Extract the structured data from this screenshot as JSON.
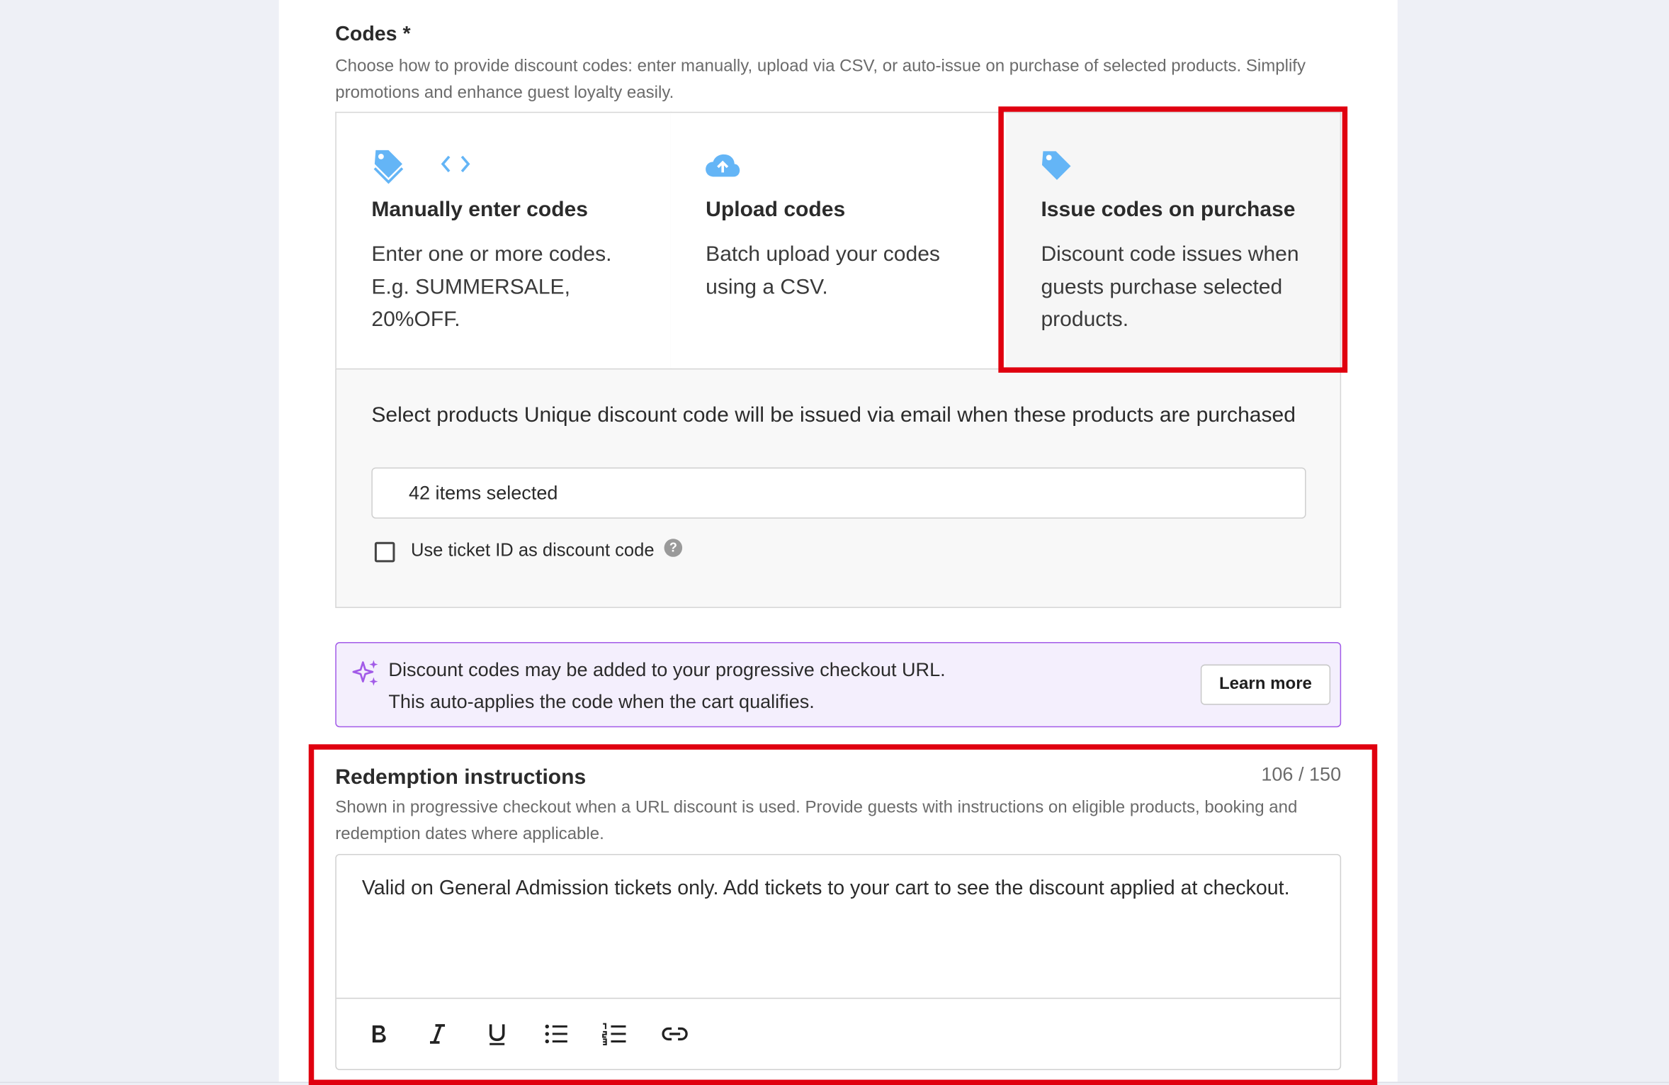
{
  "codes": {
    "title": "Codes *",
    "description": "Choose how to provide discount codes: enter manually, upload via CSV, or auto-issue on purchase of selected products. Simplify promotions and enhance guest loyalty easily."
  },
  "options": [
    {
      "title": "Manually enter codes",
      "description": "Enter one or more codes. E.g. SUMMERSALE, 20%OFF.",
      "icon": "tag-icon"
    },
    {
      "title": "Upload codes",
      "description": "Batch upload your codes using a CSV.",
      "icon": "cloud-upload-icon"
    },
    {
      "title": "Issue codes on purchase",
      "description": "Discount code issues when guests purchase selected products.",
      "icon": "tag-icon",
      "selected": true
    }
  ],
  "select_products": {
    "label": "Select products Unique discount code will be issued via email when these products are purchased",
    "value": "42 items selected",
    "checkbox_label": "Use ticket ID as discount code",
    "checkbox_checked": false
  },
  "banner": {
    "line1": "Discount codes may be added to your progressive checkout URL.",
    "line2": "This auto-applies the code when the cart qualifies.",
    "button": "Learn more"
  },
  "redemption": {
    "title": "Redemption instructions",
    "counter": "106 / 150",
    "description": "Shown in progressive checkout when a URL discount is used. Provide guests with instructions on eligible products, booking and redemption dates where applicable.",
    "text": "Valid on General Admission tickets only. Add tickets to your cart to see the discount applied at checkout.",
    "toolbar": [
      "bold-icon",
      "italic-icon",
      "underline-icon",
      "bullet-list-icon",
      "numbered-list-icon",
      "link-icon"
    ]
  },
  "colors": {
    "accent_blue": "#64b5f6",
    "highlight_red": "#e0000f",
    "banner_purple": "#a25be8"
  }
}
